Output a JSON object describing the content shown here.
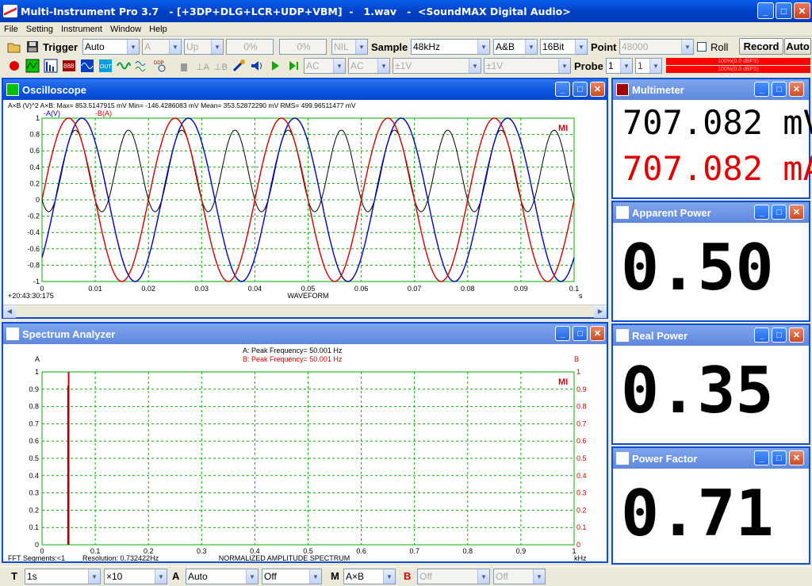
{
  "window": {
    "title": "Multi-Instrument Pro 3.7   - [+3DP+DLG+LCR+UDP+VBM]  -   1.wav   -  <SoundMAX Digital Audio>",
    "minimize": "_",
    "maximize": "□",
    "close": "✕"
  },
  "menu": [
    "File",
    "Setting",
    "Instrument",
    "Window",
    "Help"
  ],
  "toolbar1": {
    "trigger_label": "Trigger",
    "trigger_mode": "Auto",
    "channel": "A",
    "edge": "Up",
    "level1": "0%",
    "level2": "0%",
    "nil": "NIL",
    "sample_label": "Sample",
    "sample_rate": "48kHz",
    "channels": "A&B",
    "bits": "16Bit",
    "point_label": "Point",
    "points": "48000",
    "roll_label": "Roll",
    "record_label": "Record",
    "auto_label": "Auto"
  },
  "toolbar2": {
    "coupling_a": "AC",
    "coupling_b": "AC",
    "range_a": "±1V",
    "range_b": "±1V",
    "probe_label": "Probe",
    "probe_a": "1",
    "probe_b": "1",
    "meter_a": "100%(0.0 dBFS)",
    "meter_b": "100%(0.0 dBFS)"
  },
  "oscilloscope": {
    "title": "Oscilloscope",
    "stats": "A×B (V)^2         A×B: Max=     853.5147915  mV  Min=     -146.4286083  mV  Mean=     353.52872290  mV  RMS=     499.96511477  mV",
    "legend_a": "-A(V)",
    "legend_b": "-B(A)",
    "logo": "MI",
    "timestamp": "+20:43:30:175",
    "xlabel": "WAVEFORM",
    "xunit": "s"
  },
  "spectrum": {
    "title": "Spectrum Analyzer",
    "peak_a": "A: Peak Frequency=        50.001     Hz",
    "peak_b": "B: Peak Frequency=        50.001     Hz",
    "left_axis": "A",
    "right_axis": "B",
    "logo": "MI",
    "segments": "FFT Segments:<1",
    "resolution": "Resolution: 0.732422Hz",
    "xlabel": "NORMALIZED AMPLITUDE SPECTRUM",
    "xunit": "kHz"
  },
  "multimeter": {
    "title": "Multimeter",
    "voltage": "707.082 mV",
    "current": "707.082 mA"
  },
  "apparent_power": {
    "title": "Apparent Power",
    "value": "0.50 W"
  },
  "real_power": {
    "title": "Real Power",
    "value": "0.35 W"
  },
  "power_factor": {
    "title": "Power Factor",
    "value": "0.71"
  },
  "statusbar": {
    "t_label": "T",
    "time_base": "1s",
    "zoom": "×10",
    "a_label": "A",
    "a_mode": "Auto",
    "off1": "Off",
    "m_label": "M",
    "m_mode": "A×B",
    "b_label": "B",
    "off2": "Off",
    "off3": "Off"
  },
  "colors": {
    "channel_a": "#d00000",
    "channel_b": "#0000b0",
    "product": "#000000",
    "grid": "#00b000",
    "title_blue": "#0a54dc"
  },
  "chart_data": [
    {
      "type": "line",
      "x_range": [
        0,
        0.1
      ],
      "y_range": [
        -1,
        1
      ],
      "frequency_hz": 50,
      "x_ticks": [
        "0",
        "0.01",
        "0.02",
        "0.03",
        "0.04",
        "0.05",
        "0.06",
        "0.07",
        "0.08",
        "0.09",
        "0.1"
      ],
      "y_ticks": [
        "1",
        "0.8",
        "0.6",
        "0.4",
        "0.2",
        "0",
        "-0.2",
        "-0.4",
        "-0.6",
        "-0.8",
        "-1"
      ],
      "series": [
        {
          "name": "-A(V)",
          "amplitude": 1,
          "phase_deg": 0
        },
        {
          "name": "-B(A)",
          "amplitude": 1,
          "phase_deg": -45
        },
        {
          "name": "A×B",
          "max": 0.8535,
          "min": -0.1464,
          "mean": 0.3535
        }
      ]
    },
    {
      "type": "bar",
      "x_range": [
        0,
        1
      ],
      "y_range": [
        0,
        1
      ],
      "x_ticks": [
        "0",
        "0.1",
        "0.2",
        "0.3",
        "0.4",
        "0.5",
        "0.6",
        "0.7",
        "0.8",
        "0.9",
        "1"
      ],
      "y_ticks_left": [
        "1",
        "0.9",
        "0.8",
        "0.7",
        "0.6",
        "0.5",
        "0.4",
        "0.3",
        "0.2",
        "0.1",
        "0"
      ],
      "y_ticks_right": [
        "1",
        "0.9",
        "0.8",
        "0.7",
        "0.6",
        "0.5",
        "0.4",
        "0.3",
        "0.2",
        "0.1",
        "0"
      ],
      "peak_khz": 0.05,
      "peak_value": 1
    }
  ]
}
